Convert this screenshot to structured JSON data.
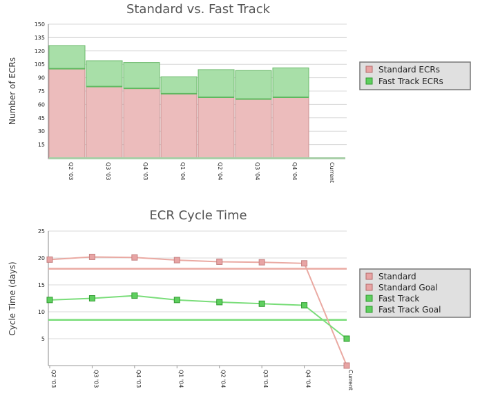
{
  "colors": {
    "standard": "#e8a4a4",
    "standard_fill": "#ecbcbc",
    "standard_line": "#eaa9a2",
    "fast": "#5fcf5f",
    "fast_fill": "#a8dfa8",
    "fast_line": "#79dd79",
    "grid": "#d8d8d8",
    "legend_bg": "#e0e0e0"
  },
  "chart_data": [
    {
      "type": "bar",
      "stacked": true,
      "title": "Standard vs. Fast Track",
      "ylabel": "Number of ECRs",
      "xlabel": "",
      "categories": [
        "Q2 '03",
        "Q3 '03",
        "Q4 '03",
        "Q1 '04",
        "Q2 '04",
        "Q3 '04",
        "Q4 '04",
        "Current"
      ],
      "ylim": [
        0,
        150
      ],
      "yticks": [
        15,
        30,
        45,
        60,
        75,
        90,
        105,
        120,
        135,
        150
      ],
      "grid": true,
      "legend_position": "right",
      "series": [
        {
          "name": "Standard ECRs",
          "values": [
            100,
            80,
            78,
            72,
            68,
            66,
            68,
            0
          ]
        },
        {
          "name": "Fast Track ECRs",
          "values": [
            26,
            29,
            29,
            19,
            31,
            32,
            33,
            0
          ]
        }
      ]
    },
    {
      "type": "line",
      "title": "ECR Cycle Time",
      "ylabel": "Cycle Time (days)",
      "xlabel": "",
      "categories": [
        "Q2 '03",
        "Q3 '03",
        "Q4 '03",
        "Q1 '04",
        "Q2 '04",
        "Q3 '04",
        "Q4 '04",
        "Current"
      ],
      "ylim": [
        0,
        25
      ],
      "yticks": [
        5,
        10,
        15,
        20,
        25
      ],
      "grid": true,
      "legend_position": "right",
      "series": [
        {
          "name": "Standard",
          "values": [
            19.7,
            20.2,
            20.1,
            19.6,
            19.3,
            19.2,
            19.0,
            0
          ]
        },
        {
          "name": "Standard Goal",
          "values": [
            18,
            18,
            18,
            18,
            18,
            18,
            18,
            18
          ]
        },
        {
          "name": "Fast Track",
          "values": [
            12.2,
            12.5,
            13.0,
            12.2,
            11.8,
            11.5,
            11.2,
            5
          ]
        },
        {
          "name": "Fast Track Goal",
          "values": [
            8.5,
            8.5,
            8.5,
            8.5,
            8.5,
            8.5,
            8.5,
            8.5
          ]
        }
      ]
    }
  ]
}
